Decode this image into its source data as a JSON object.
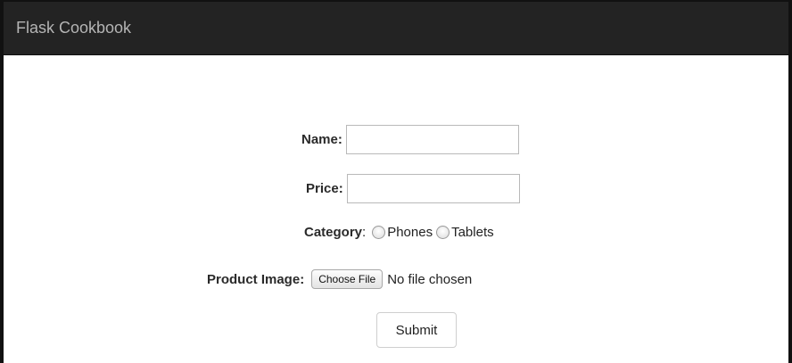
{
  "app": {
    "brand": "Flask Cookbook"
  },
  "form": {
    "name_label": "Name",
    "name_value": "",
    "price_label": "Price",
    "price_value": "",
    "category_label": "Category",
    "category_options": [
      "Phones",
      "Tablets"
    ],
    "image_label": "Product Image",
    "choose_file_label": "Choose File",
    "file_status": "No file chosen",
    "submit_label": "Submit",
    "colon": ":"
  }
}
